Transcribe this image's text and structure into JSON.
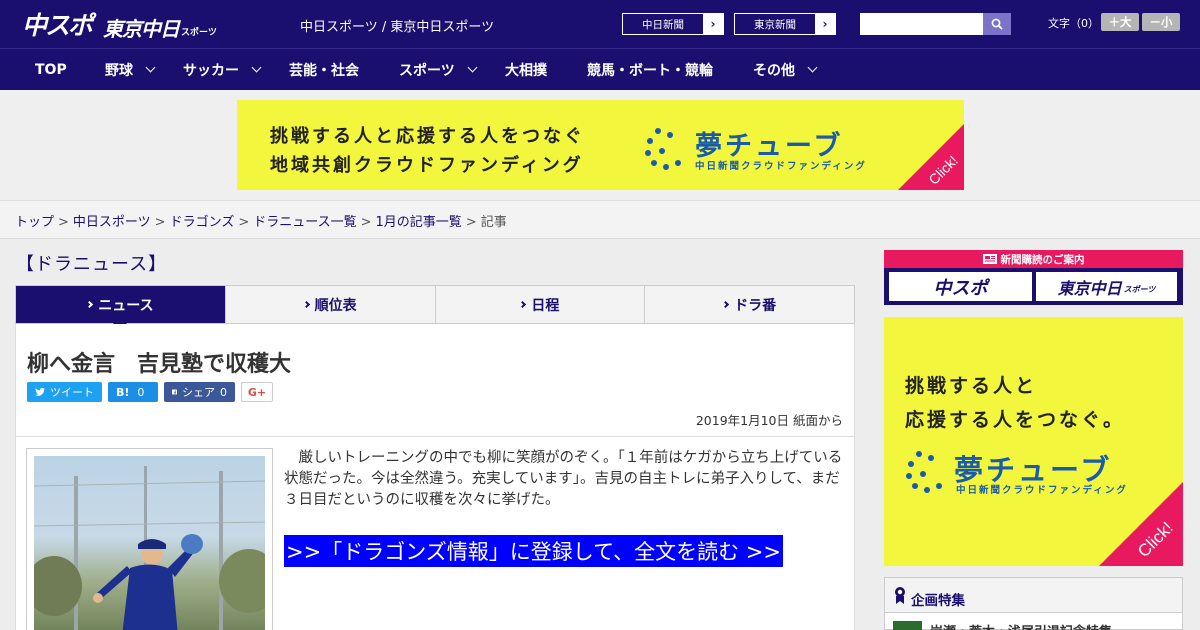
{
  "header": {
    "logo_main": "中スポ",
    "logo_sub": "東京中日",
    "logo_sub_small": "スポーツ",
    "site_title": "中日スポーツ / 東京中日スポーツ",
    "ext_links": [
      {
        "label": "中日新聞",
        "arrow": "›"
      },
      {
        "label": "東京新聞",
        "arrow": "›"
      }
    ],
    "search": {
      "value": "",
      "placeholder": ""
    },
    "fontsize_label": "文字（0）",
    "font_larger": "＋大",
    "font_smaller": "－小"
  },
  "nav": {
    "items": [
      {
        "label": "TOP",
        "dropdown": false
      },
      {
        "label": "野球",
        "dropdown": true
      },
      {
        "label": "サッカー",
        "dropdown": true
      },
      {
        "label": "芸能・社会",
        "dropdown": false
      },
      {
        "label": "スポーツ",
        "dropdown": true
      },
      {
        "label": "大相撲",
        "dropdown": false
      },
      {
        "label": "競馬・ボート・競輪",
        "dropdown": false
      },
      {
        "label": "その他",
        "dropdown": true
      }
    ]
  },
  "banner": {
    "line1": "挑戦する人と応援する人をつなぐ",
    "line2": "地域共創クラウドファンディング",
    "brand": "夢チューブ",
    "brand_sub": "中日新聞クラウドファンディング",
    "click": "Click!"
  },
  "breadcrumb": {
    "items": [
      "トップ",
      "中日スポーツ",
      "ドラゴンズ",
      "ドラニュース一覧",
      "1月の記事一覧"
    ],
    "current": "記事",
    "separator": ">"
  },
  "section": {
    "title": "【ドラニュース】"
  },
  "tabs": [
    {
      "label": "ニュース",
      "active": true
    },
    {
      "label": "順位表",
      "active": false
    },
    {
      "label": "日程",
      "active": false
    },
    {
      "label": "ドラ番",
      "active": false
    }
  ],
  "article": {
    "headline": "柳へ金言　吉見塾で収穫大",
    "social": {
      "tweet_label": "ツイート",
      "hatena_label": "B!",
      "hatena_count": "0",
      "facebook_label": "シェア",
      "facebook_count": "0",
      "gplus_label": "G+"
    },
    "dateline": "2019年1月10日 紙面から",
    "body": "　厳しいトレーニングの中でも柳に笑顔がのぞく。「１年前はケガから立ち上げている状態だった。今は全然違う。充実しています」。吉見の自主トレに弟子入りして、まだ３日目だというのに収穫を次々に挙げた。",
    "read_more": ">>「ドラゴンズ情報」に登録して、全文を読む >>"
  },
  "sidebar": {
    "subscribe_head": "新聞購読のご案内",
    "subscribe_logo1": "中スポ",
    "subscribe_logo2": "東京中日",
    "subscribe_logo2_small": "スポーツ",
    "ad": {
      "line1": "挑戦する人と",
      "line2": "応援する人をつなぐ。",
      "brand": "夢チューブ",
      "brand_sub": "中日新聞クラウドファンディング",
      "click": "Click!"
    },
    "feature_title": "企画特集",
    "feature_item": "岩瀬・荒木・浅尾引退記念特集"
  },
  "colors": {
    "brand_navy": "#1a0f6e",
    "ad_yellow": "#f2f63d",
    "ad_blue": "#1a5bab",
    "accent_pink": "#e8195f",
    "readmore_blue": "#0000ff"
  },
  "icons": [
    "search-icon",
    "chevron-down-icon",
    "twitter-icon",
    "facebook-icon",
    "badge-icon",
    "newspaper-icon"
  ]
}
